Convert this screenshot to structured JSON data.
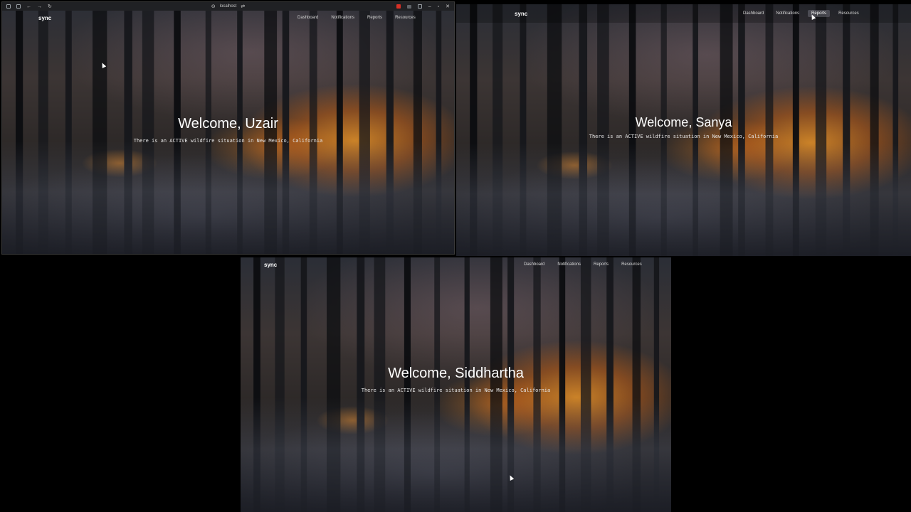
{
  "browser": {
    "url": "localhost"
  },
  "site": {
    "brand": "sync",
    "nav": [
      "Dashboard",
      "Notifications",
      "Reports",
      "Resources"
    ],
    "alert": "There is an ACTIVE wildfire situation in New Mexico, California"
  },
  "panels": [
    {
      "welcome": "Welcome, Uzair",
      "active_nav": ""
    },
    {
      "welcome": "Welcome, Sanya",
      "active_nav": "Reports"
    },
    {
      "welcome": "Welcome, Siddhartha",
      "active_nav": ""
    }
  ],
  "colors": {
    "background": "#000000",
    "fire_glow": "#ffa028",
    "text": "#ffffff"
  }
}
